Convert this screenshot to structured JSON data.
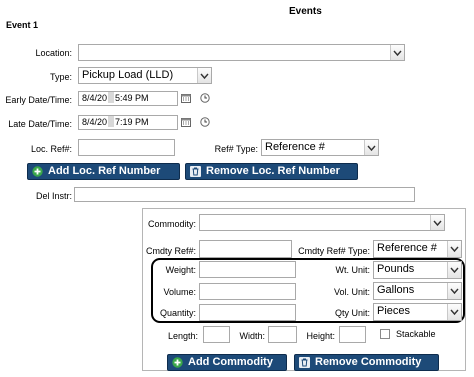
{
  "header": {
    "title": "Events",
    "section": "Event 1"
  },
  "form": {
    "location": {
      "label": "Location:",
      "value": ""
    },
    "type": {
      "label": "Type:",
      "value": "Pickup Load (LLD)"
    },
    "early": {
      "label": "Early Date/Time:",
      "date": "8/4/20",
      "time": "5:49 PM"
    },
    "late": {
      "label": "Late Date/Time:",
      "date": "8/4/20",
      "time": "7:19 PM"
    },
    "locref": {
      "label": "Loc. Ref#:",
      "value": ""
    },
    "reftype": {
      "label": "Ref# Type:",
      "value": "Reference #"
    },
    "add_loc_ref": "Add Loc. Ref Number",
    "remove_loc_ref": "Remove Loc. Ref Number",
    "del_instr": {
      "label": "Del Instr:",
      "value": ""
    }
  },
  "commodity": {
    "commodity": {
      "label": "Commodity:",
      "value": ""
    },
    "cmdty_ref": {
      "label": "Cmdty Ref#:",
      "value": ""
    },
    "cmdty_ref_type": {
      "label": "Cmdty Ref# Type:",
      "value": "Reference #"
    },
    "weight": {
      "label": "Weight:",
      "value": ""
    },
    "wt_unit": {
      "label": "Wt. Unit:",
      "value": "Pounds"
    },
    "volume": {
      "label": "Volume:",
      "value": ""
    },
    "vol_unit": {
      "label": "Vol. Unit:",
      "value": "Gallons"
    },
    "quantity": {
      "label": "Quantity:",
      "value": ""
    },
    "qty_unit": {
      "label": "Qty Unit:",
      "value": "Pieces"
    },
    "length": {
      "label": "Length:",
      "value": ""
    },
    "width": {
      "label": "Width:",
      "value": ""
    },
    "height": {
      "label": "Height:",
      "value": ""
    },
    "stackable": {
      "label": "Stackable",
      "checked": false
    },
    "add_commodity": "Add Commodity",
    "remove_commodity": "Remove Commodity"
  },
  "colors": {
    "button_bg": "#1d4a78",
    "add_icon": "#3aa64a",
    "highlight_border": "#000000"
  },
  "icons": [
    "chevron-down-icon",
    "calendar-icon",
    "clock-icon",
    "plus-icon",
    "trash-icon"
  ]
}
